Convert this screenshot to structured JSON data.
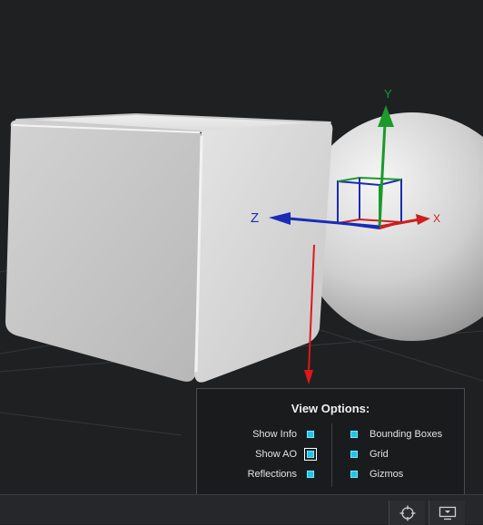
{
  "viewport": {
    "gizmo": {
      "axis_x_label": "X",
      "axis_y_label": "Y",
      "axis_z_label": "Z",
      "colors": {
        "x": "#cc1f1f",
        "y": "#1b9a2a",
        "z": "#1a2bb5"
      }
    }
  },
  "view_options": {
    "title": "View Options:",
    "left_options": [
      {
        "label": "Show Info",
        "checked": true
      },
      {
        "label": "Show AO",
        "checked": true
      },
      {
        "label": "Reflections",
        "checked": true
      }
    ],
    "right_options": [
      {
        "label": "Bounding Boxes",
        "checked": true
      },
      {
        "label": "Grid",
        "checked": true
      },
      {
        "label": "Gizmos",
        "checked": true
      }
    ],
    "checkbox_color": "#27c3e4"
  },
  "status_bar": {
    "buttons": [
      {
        "icon": "crosshair-icon"
      },
      {
        "icon": "monitor-icon"
      }
    ]
  }
}
